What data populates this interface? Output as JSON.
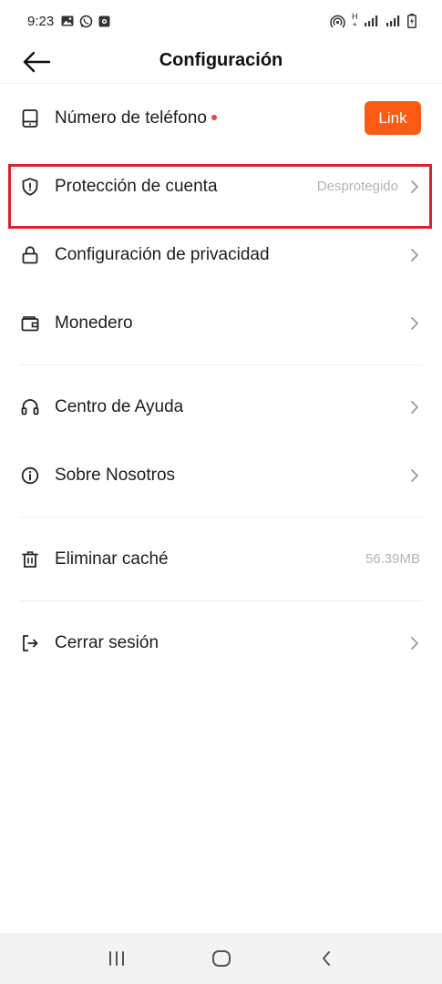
{
  "status_bar": {
    "time": "9:23",
    "network_label_top": "H",
    "network_label_bottom": "+"
  },
  "header": {
    "title": "Configuración",
    "back_icon": "arrow-left-icon"
  },
  "settings": {
    "phone": {
      "label": "Número de teléfono",
      "button": "Link",
      "icon": "phone-device-icon",
      "dot_color": "#f04141"
    },
    "account_protection": {
      "label": "Protección de cuenta",
      "value": "Desprotegido",
      "icon": "shield-icon"
    },
    "privacy": {
      "label": "Configuración de privacidad",
      "icon": "lock-icon"
    },
    "wallet": {
      "label": "Monedero",
      "icon": "wallet-icon"
    },
    "help": {
      "label": "Centro de Ayuda",
      "icon": "headset-icon"
    },
    "about": {
      "label": "Sobre Nosotros",
      "icon": "info-icon"
    },
    "cache": {
      "label": "Eliminar caché",
      "value": "56.39MB",
      "icon": "trash-icon"
    },
    "logout": {
      "label": "Cerrar sesión",
      "icon": "logout-icon"
    }
  },
  "colors": {
    "accent": "#fd5a13",
    "highlight_border": "#d6232d",
    "secondary_text": "#b4b4b4"
  },
  "nav_bar": {
    "recents_icon": "recents-icon",
    "home_icon": "home-icon",
    "back_icon": "nav-back-icon"
  }
}
